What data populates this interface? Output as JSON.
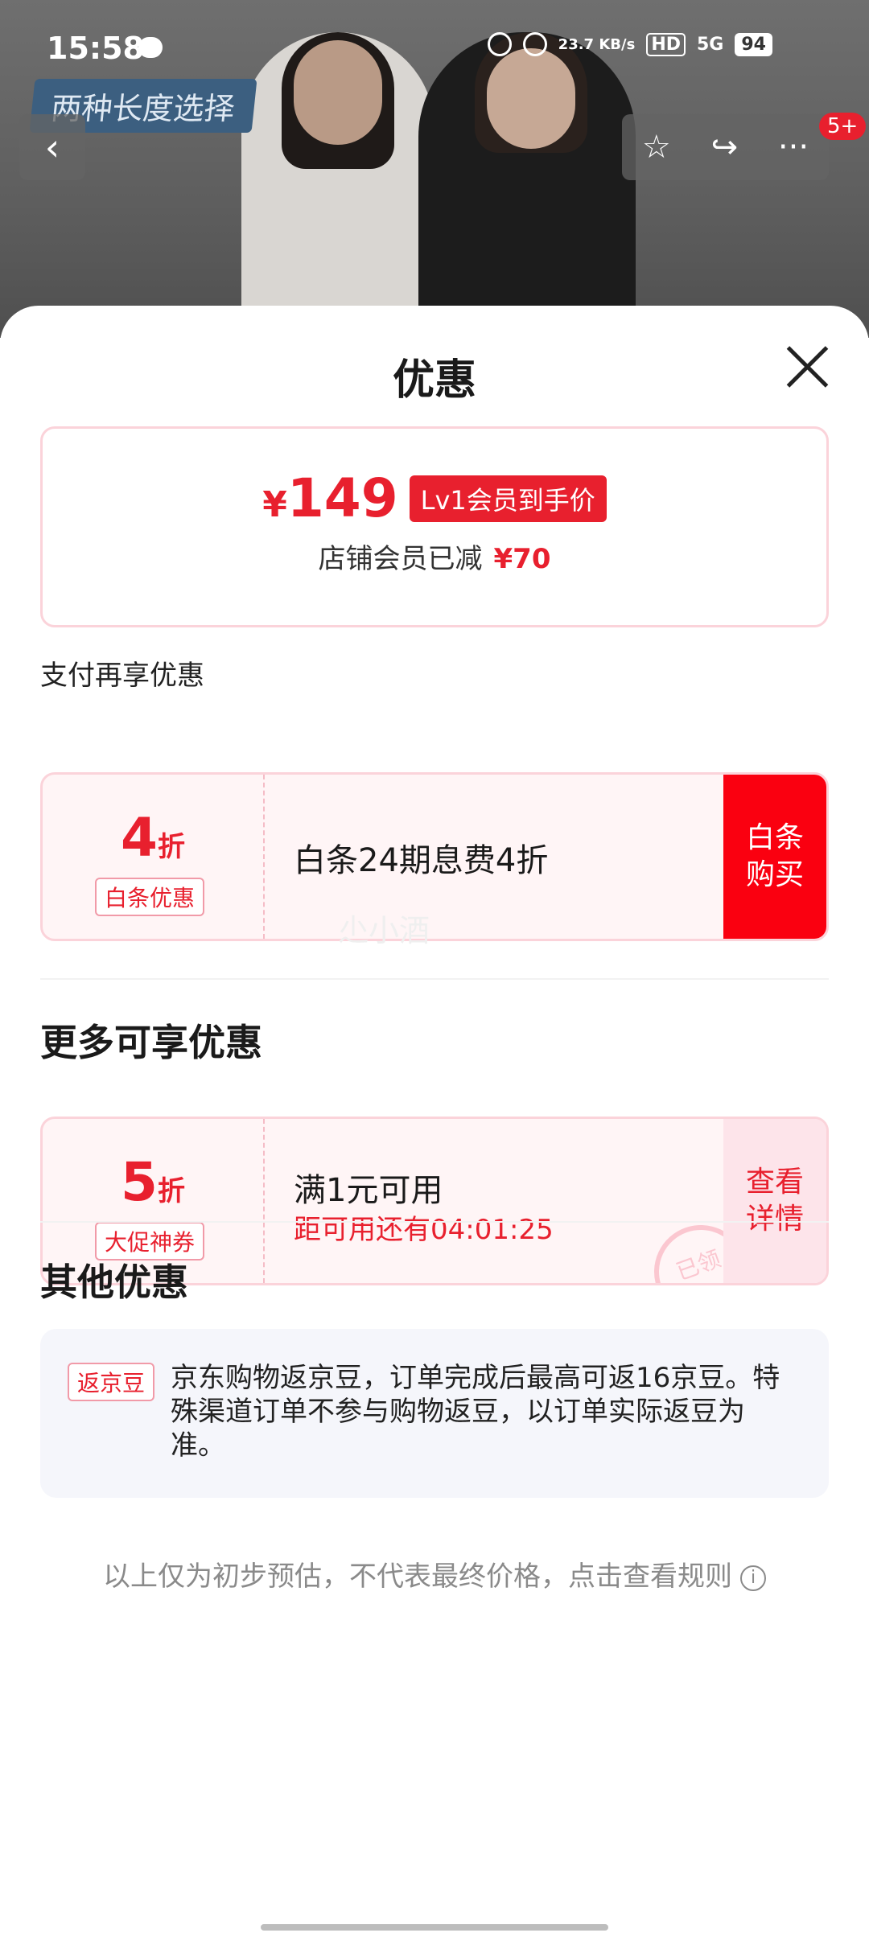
{
  "status_bar": {
    "time": "15:58",
    "net_speed": "23.7 KB/s",
    "hd": "HD",
    "signal": "5G",
    "battery": "94"
  },
  "background": {
    "banner_text": "两种长度选择",
    "badge": "5+"
  },
  "sheet": {
    "title": "优惠",
    "price_card": {
      "currency": "¥",
      "price": "149",
      "tag": "Lv1会员到手价",
      "reduce_label": "店铺会员已减",
      "reduce_amount": "¥70"
    },
    "pay_section_title": "支付再享优惠",
    "baitiao": {
      "discount": "4",
      "discount_unit": "折",
      "tag": "白条优惠",
      "text": "白条24期息费4折",
      "button": "白条\n购买"
    },
    "more_title": "更多可享优惠",
    "promo_coupon": {
      "discount": "5",
      "discount_unit": "折",
      "tag": "大促神券",
      "condition": "满1元可用",
      "countdown": "距可用还有04:01:25",
      "button": "查看\n详情",
      "stamp": "已领"
    },
    "watermark": "尐小酒",
    "other_title": "其他优惠",
    "other": {
      "tag": "返京豆",
      "text": "京东购物返京豆，订单完成后最高可返16京豆。特殊渠道订单不参与购物返豆，以订单实际返豆为准。"
    },
    "footnote": "以上仅为初步预估，不代表最终价格，点击查看规则",
    "info_icon_glyph": "i"
  },
  "colors": {
    "accent": "#e8202e",
    "button_red": "#fa0010",
    "card_border": "#fbd3da"
  }
}
